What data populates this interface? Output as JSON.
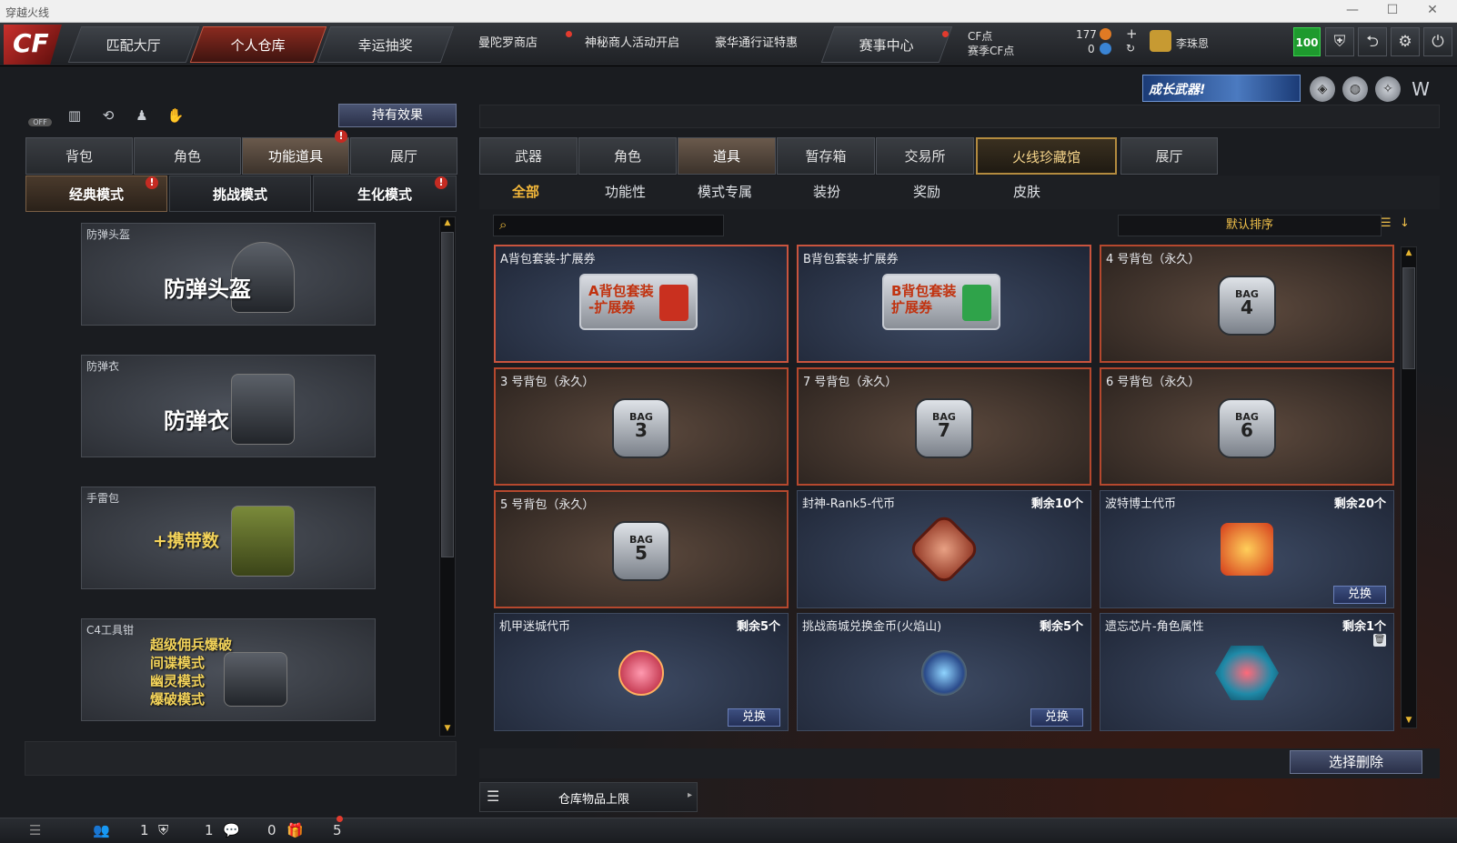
{
  "window": {
    "title": "穿越火线",
    "minimize": "—",
    "maximize": "☐",
    "close": "✕"
  },
  "topnav": {
    "logo": "CF",
    "tabs": [
      "匹配大厅",
      "个人仓库",
      "幸运抽奖"
    ],
    "links": [
      "曼陀罗商店",
      "神秘商人活动开启",
      "豪华通行证特惠"
    ],
    "event_tab": "赛事中心",
    "cf_label": "CF点",
    "cf_value": "177",
    "season_label": "赛季CF点",
    "season_value": "0",
    "plus": "+",
    "refresh": "↻",
    "username": "李珠恩",
    "level": "100"
  },
  "left": {
    "hold_button": "持有效果",
    "off_label": "OFF",
    "tabs": [
      "背包",
      "角色",
      "功能道具",
      "展厅"
    ],
    "modes": [
      "经典模式",
      "挑战模式",
      "生化模式"
    ],
    "items": [
      {
        "label": "防弹头盔",
        "big": "防弹头盔"
      },
      {
        "label": "防弹衣",
        "big": "防弹衣"
      },
      {
        "label": "手雷包",
        "big": "+携带数"
      },
      {
        "label": "C4工具钳",
        "big_lines": [
          "超级佣兵爆破",
          "间谍模式",
          "幽灵模式",
          "爆破模式"
        ]
      }
    ]
  },
  "right": {
    "grow_banner": "成长武器!",
    "tabs": [
      "武器",
      "角色",
      "道具",
      "暂存箱",
      "交易所",
      "火线珍藏馆",
      "展厅"
    ],
    "subtabs": [
      "全部",
      "功能性",
      "模式专属",
      "装扮",
      "奖励",
      "皮肤"
    ],
    "sort_label": "默认排序",
    "cards": [
      {
        "title": "A背包套装-扩展券",
        "art": "A背包套装\n-扩展券"
      },
      {
        "title": "B背包套装-扩展券",
        "art": "B背包套装\n扩展券"
      },
      {
        "title": "4 号背包（永久）",
        "bag": "4"
      },
      {
        "title": "3 号背包（永久）",
        "bag": "3"
      },
      {
        "title": "7 号背包（永久）",
        "bag": "7"
      },
      {
        "title": "6 号背包（永久）",
        "bag": "6"
      },
      {
        "title": "5 号背包（永久）",
        "bag": "5"
      },
      {
        "title": "封神-Rank5-代币",
        "remain": "剩余10个"
      },
      {
        "title": "波特博士代币",
        "remain": "剩余20个",
        "exchange": "兑换"
      },
      {
        "title": "机甲迷城代币",
        "remain": "剩余5个",
        "exchange": "兑换"
      },
      {
        "title": "挑战商城兑换金币(火焰山)",
        "remain": "剩余5个",
        "exchange": "兑换"
      },
      {
        "title": "遗忘芯片-角色属性",
        "remain": "剩余1个"
      }
    ],
    "bag_text": "BAG",
    "capacity_label": "仓库物品上限",
    "delete_button": "选择删除"
  },
  "statusbar": {
    "values": [
      "1",
      "1",
      "0",
      "5"
    ]
  }
}
